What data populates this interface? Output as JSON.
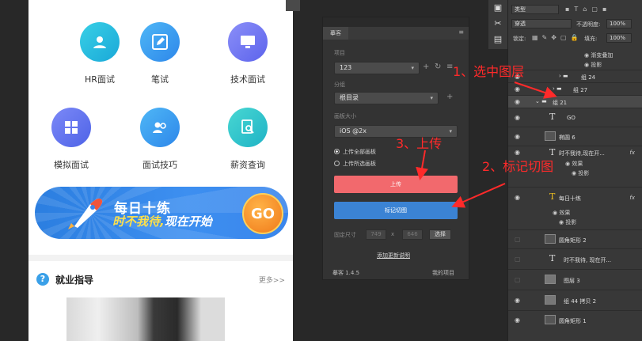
{
  "phone": {
    "grid": [
      {
        "label": "HR面试",
        "icon": "user-card-icon"
      },
      {
        "label": "笔试",
        "icon": "pencil-icon"
      },
      {
        "label": "技术面试",
        "icon": "monitor-icon"
      },
      {
        "label": "模拟面试",
        "icon": "grid-icon"
      },
      {
        "label": "面试技巧",
        "icon": "people-icon"
      },
      {
        "label": "薪资查询",
        "icon": "search-doc-icon"
      }
    ],
    "banner": {
      "line1": "每日十练",
      "line2a": "时不我待,",
      "line2b": "现在开始",
      "go": "GO"
    },
    "section": {
      "title": "就业指导",
      "more": "更多>>",
      "badge": "?"
    }
  },
  "plugin": {
    "tab": "摹客",
    "project_label": "项目",
    "project_value": "123",
    "group_label": "分组",
    "group_value": "根目录",
    "size_label": "画板大小",
    "size_value": "iOS @2x",
    "radio_all": "上传全部画板",
    "radio_selected": "上传所选画板",
    "upload_btn": "上传",
    "mark_btn": "标记切图",
    "fixed_label": "固定尺寸",
    "fixed_w": "749",
    "fixed_x": "x",
    "fixed_h": "646",
    "fixed_ok": "选择",
    "update_link": "添加更新说明",
    "version": "摹客 1.4.5",
    "my_project": "我的项目"
  },
  "layers": {
    "kind_filter": "类型",
    "blend_mode": "穿透",
    "opacity_label": "不透明度:",
    "opacity_value": "100%",
    "lock_label": "锁定:",
    "fill_label": "填充:",
    "fill_value": "100%",
    "items": [
      {
        "name": "渐变叠加",
        "type": "effect"
      },
      {
        "name": "投影",
        "type": "effect"
      },
      {
        "name": "组 24",
        "type": "group"
      },
      {
        "name": "组 27",
        "type": "group"
      },
      {
        "name": "组 21",
        "type": "group-selected"
      },
      {
        "name": "GO",
        "type": "text"
      },
      {
        "name": "椭圆 6",
        "type": "shape"
      },
      {
        "name": "时不我待,现在开...",
        "type": "text-fx",
        "fx": "fx"
      },
      {
        "name": "效果",
        "type": "effect"
      },
      {
        "name": "投影",
        "type": "effect"
      },
      {
        "name": "每日十练",
        "type": "text-fx",
        "fx": "fx"
      },
      {
        "name": "效果",
        "type": "effect"
      },
      {
        "name": "投影",
        "type": "effect"
      },
      {
        "name": "圆角矩形 2",
        "type": "shape"
      },
      {
        "name": "时不我待, 现在开...",
        "type": "text"
      },
      {
        "name": "图层 3",
        "type": "image"
      },
      {
        "name": "组 44 拷贝 2",
        "type": "image"
      },
      {
        "name": "圆角矩形 1",
        "type": "shape"
      }
    ]
  },
  "annotations": {
    "step1": "1、选中图层",
    "step2": "2、标记切图",
    "step3": "3、上传",
    "color": "#ff2a2a"
  }
}
